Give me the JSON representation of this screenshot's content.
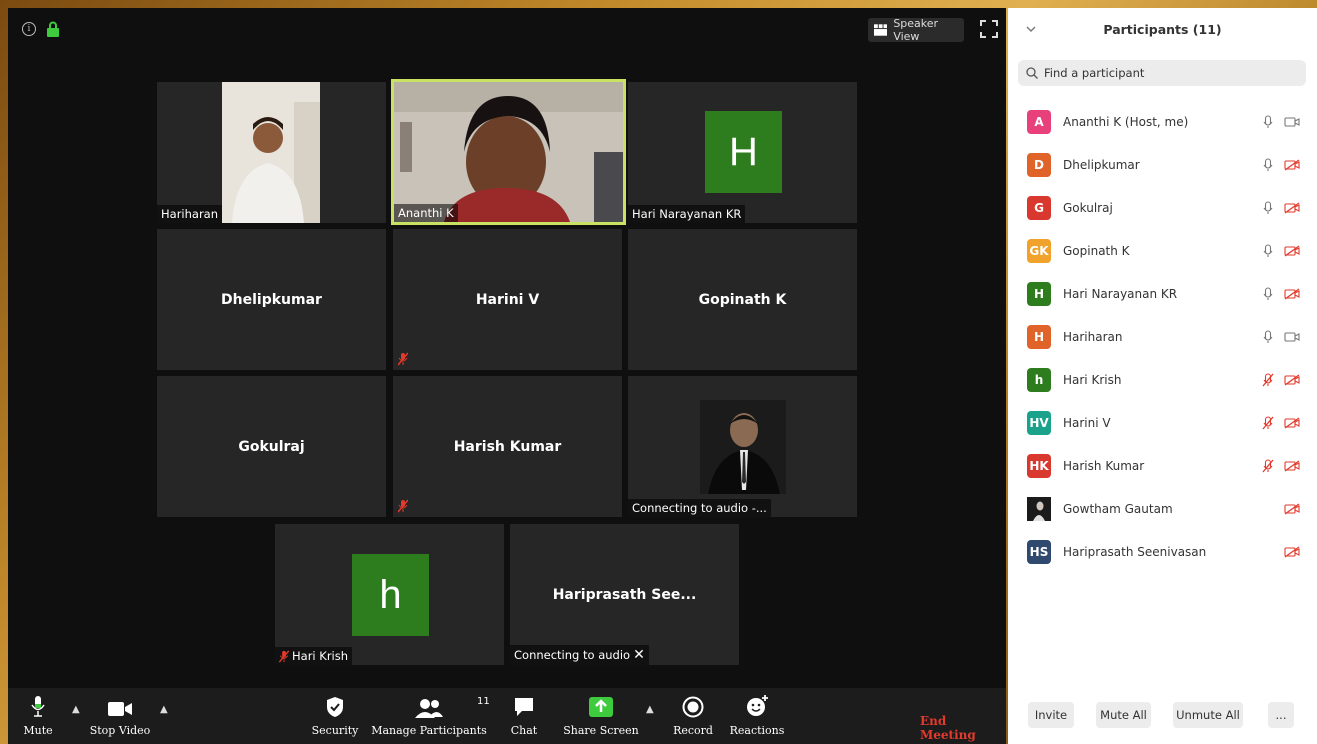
{
  "top_bar": {
    "speaker_view": "Speaker View"
  },
  "tiles": {
    "hariharan": "Hariharan",
    "ananthi": "Ananthi K",
    "hari_narayanan": "Hari Narayanan KR",
    "hari_narayanan_initial": "H",
    "dhelipkumar": "Dhelipkumar",
    "harini": "Harini V",
    "gopinath": "Gopinath K",
    "gokulraj": "Gokulraj",
    "harish": "Harish Kumar",
    "gowtham_caption": "Connecting to audio -...",
    "hari_krish": "Hari Krish",
    "hari_krish_initial": "h",
    "hariprasath": "Hariprasath See...",
    "hariprasath_caption": "Connecting to audio"
  },
  "toolbar": {
    "mute": "Mute",
    "stop_video": "Stop Video",
    "security": "Security",
    "manage_participants": "Manage Participants",
    "participant_count": "11",
    "chat": "Chat",
    "share_screen": "Share Screen",
    "record": "Record",
    "reactions": "Reactions",
    "end_meeting": "End Meeting"
  },
  "panel": {
    "title": "Participants (11)",
    "search_placeholder": "Find a participant",
    "participants": [
      {
        "initials": "A",
        "name": "Ananthi K (Host, me)",
        "color": "#e8407a",
        "mic": "on",
        "cam": "on"
      },
      {
        "initials": "D",
        "name": "Dhelipkumar",
        "color": "#e0632a",
        "mic": "on",
        "cam": "off"
      },
      {
        "initials": "G",
        "name": "Gokulraj",
        "color": "#d9382e",
        "mic": "on",
        "cam": "off"
      },
      {
        "initials": "GK",
        "name": "Gopinath K",
        "color": "#f0a22a",
        "mic": "on",
        "cam": "off"
      },
      {
        "initials": "H",
        "name": "Hari Narayanan KR",
        "color": "#2d7d1f",
        "mic": "on",
        "cam": "off"
      },
      {
        "initials": "H",
        "name": "Hariharan",
        "color": "#e0632a",
        "mic": "on",
        "cam": "on"
      },
      {
        "initials": "h",
        "name": "Hari Krish",
        "color": "#2d7d1f",
        "mic": "muted",
        "cam": "off"
      },
      {
        "initials": "HV",
        "name": "Harini V",
        "color": "#1aa38a",
        "mic": "muted",
        "cam": "off"
      },
      {
        "initials": "HK",
        "name": "Harish Kumar",
        "color": "#d9382e",
        "mic": "muted",
        "cam": "off"
      },
      {
        "initials": "",
        "name": "Gowtham Gautam",
        "color": "#222222",
        "mic": "none",
        "cam": "off"
      },
      {
        "initials": "HS",
        "name": "Hariprasath Seenivasan",
        "color": "#2f4a6e",
        "mic": "none",
        "cam": "off"
      }
    ],
    "invite": "Invite",
    "mute_all": "Mute All",
    "unmute_all": "Unmute All",
    "more": "..."
  }
}
